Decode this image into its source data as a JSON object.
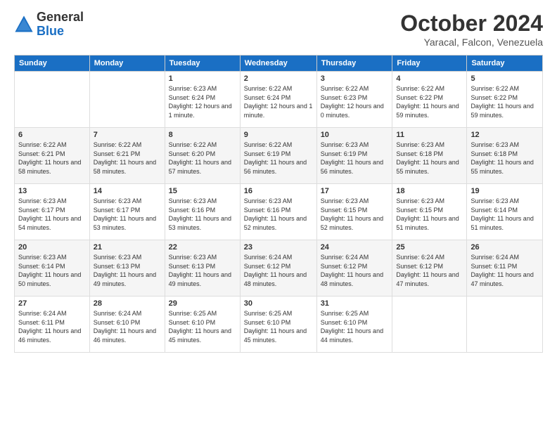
{
  "logo": {
    "general": "General",
    "blue": "Blue"
  },
  "title": "October 2024",
  "subtitle": "Yaracal, Falcon, Venezuela",
  "days_header": [
    "Sunday",
    "Monday",
    "Tuesday",
    "Wednesday",
    "Thursday",
    "Friday",
    "Saturday"
  ],
  "weeks": [
    [
      {
        "day": "",
        "sunrise": "",
        "sunset": "",
        "daylight": ""
      },
      {
        "day": "",
        "sunrise": "",
        "sunset": "",
        "daylight": ""
      },
      {
        "day": "1",
        "sunrise": "Sunrise: 6:23 AM",
        "sunset": "Sunset: 6:24 PM",
        "daylight": "Daylight: 12 hours and 1 minute."
      },
      {
        "day": "2",
        "sunrise": "Sunrise: 6:22 AM",
        "sunset": "Sunset: 6:24 PM",
        "daylight": "Daylight: 12 hours and 1 minute."
      },
      {
        "day": "3",
        "sunrise": "Sunrise: 6:22 AM",
        "sunset": "Sunset: 6:23 PM",
        "daylight": "Daylight: 12 hours and 0 minutes."
      },
      {
        "day": "4",
        "sunrise": "Sunrise: 6:22 AM",
        "sunset": "Sunset: 6:22 PM",
        "daylight": "Daylight: 11 hours and 59 minutes."
      },
      {
        "day": "5",
        "sunrise": "Sunrise: 6:22 AM",
        "sunset": "Sunset: 6:22 PM",
        "daylight": "Daylight: 11 hours and 59 minutes."
      }
    ],
    [
      {
        "day": "6",
        "sunrise": "Sunrise: 6:22 AM",
        "sunset": "Sunset: 6:21 PM",
        "daylight": "Daylight: 11 hours and 58 minutes."
      },
      {
        "day": "7",
        "sunrise": "Sunrise: 6:22 AM",
        "sunset": "Sunset: 6:21 PM",
        "daylight": "Daylight: 11 hours and 58 minutes."
      },
      {
        "day": "8",
        "sunrise": "Sunrise: 6:22 AM",
        "sunset": "Sunset: 6:20 PM",
        "daylight": "Daylight: 11 hours and 57 minutes."
      },
      {
        "day": "9",
        "sunrise": "Sunrise: 6:22 AM",
        "sunset": "Sunset: 6:19 PM",
        "daylight": "Daylight: 11 hours and 56 minutes."
      },
      {
        "day": "10",
        "sunrise": "Sunrise: 6:23 AM",
        "sunset": "Sunset: 6:19 PM",
        "daylight": "Daylight: 11 hours and 56 minutes."
      },
      {
        "day": "11",
        "sunrise": "Sunrise: 6:23 AM",
        "sunset": "Sunset: 6:18 PM",
        "daylight": "Daylight: 11 hours and 55 minutes."
      },
      {
        "day": "12",
        "sunrise": "Sunrise: 6:23 AM",
        "sunset": "Sunset: 6:18 PM",
        "daylight": "Daylight: 11 hours and 55 minutes."
      }
    ],
    [
      {
        "day": "13",
        "sunrise": "Sunrise: 6:23 AM",
        "sunset": "Sunset: 6:17 PM",
        "daylight": "Daylight: 11 hours and 54 minutes."
      },
      {
        "day": "14",
        "sunrise": "Sunrise: 6:23 AM",
        "sunset": "Sunset: 6:17 PM",
        "daylight": "Daylight: 11 hours and 53 minutes."
      },
      {
        "day": "15",
        "sunrise": "Sunrise: 6:23 AM",
        "sunset": "Sunset: 6:16 PM",
        "daylight": "Daylight: 11 hours and 53 minutes."
      },
      {
        "day": "16",
        "sunrise": "Sunrise: 6:23 AM",
        "sunset": "Sunset: 6:16 PM",
        "daylight": "Daylight: 11 hours and 52 minutes."
      },
      {
        "day": "17",
        "sunrise": "Sunrise: 6:23 AM",
        "sunset": "Sunset: 6:15 PM",
        "daylight": "Daylight: 11 hours and 52 minutes."
      },
      {
        "day": "18",
        "sunrise": "Sunrise: 6:23 AM",
        "sunset": "Sunset: 6:15 PM",
        "daylight": "Daylight: 11 hours and 51 minutes."
      },
      {
        "day": "19",
        "sunrise": "Sunrise: 6:23 AM",
        "sunset": "Sunset: 6:14 PM",
        "daylight": "Daylight: 11 hours and 51 minutes."
      }
    ],
    [
      {
        "day": "20",
        "sunrise": "Sunrise: 6:23 AM",
        "sunset": "Sunset: 6:14 PM",
        "daylight": "Daylight: 11 hours and 50 minutes."
      },
      {
        "day": "21",
        "sunrise": "Sunrise: 6:23 AM",
        "sunset": "Sunset: 6:13 PM",
        "daylight": "Daylight: 11 hours and 49 minutes."
      },
      {
        "day": "22",
        "sunrise": "Sunrise: 6:23 AM",
        "sunset": "Sunset: 6:13 PM",
        "daylight": "Daylight: 11 hours and 49 minutes."
      },
      {
        "day": "23",
        "sunrise": "Sunrise: 6:24 AM",
        "sunset": "Sunset: 6:12 PM",
        "daylight": "Daylight: 11 hours and 48 minutes."
      },
      {
        "day": "24",
        "sunrise": "Sunrise: 6:24 AM",
        "sunset": "Sunset: 6:12 PM",
        "daylight": "Daylight: 11 hours and 48 minutes."
      },
      {
        "day": "25",
        "sunrise": "Sunrise: 6:24 AM",
        "sunset": "Sunset: 6:12 PM",
        "daylight": "Daylight: 11 hours and 47 minutes."
      },
      {
        "day": "26",
        "sunrise": "Sunrise: 6:24 AM",
        "sunset": "Sunset: 6:11 PM",
        "daylight": "Daylight: 11 hours and 47 minutes."
      }
    ],
    [
      {
        "day": "27",
        "sunrise": "Sunrise: 6:24 AM",
        "sunset": "Sunset: 6:11 PM",
        "daylight": "Daylight: 11 hours and 46 minutes."
      },
      {
        "day": "28",
        "sunrise": "Sunrise: 6:24 AM",
        "sunset": "Sunset: 6:10 PM",
        "daylight": "Daylight: 11 hours and 46 minutes."
      },
      {
        "day": "29",
        "sunrise": "Sunrise: 6:25 AM",
        "sunset": "Sunset: 6:10 PM",
        "daylight": "Daylight: 11 hours and 45 minutes."
      },
      {
        "day": "30",
        "sunrise": "Sunrise: 6:25 AM",
        "sunset": "Sunset: 6:10 PM",
        "daylight": "Daylight: 11 hours and 45 minutes."
      },
      {
        "day": "31",
        "sunrise": "Sunrise: 6:25 AM",
        "sunset": "Sunset: 6:10 PM",
        "daylight": "Daylight: 11 hours and 44 minutes."
      },
      {
        "day": "",
        "sunrise": "",
        "sunset": "",
        "daylight": ""
      },
      {
        "day": "",
        "sunrise": "",
        "sunset": "",
        "daylight": ""
      }
    ]
  ]
}
